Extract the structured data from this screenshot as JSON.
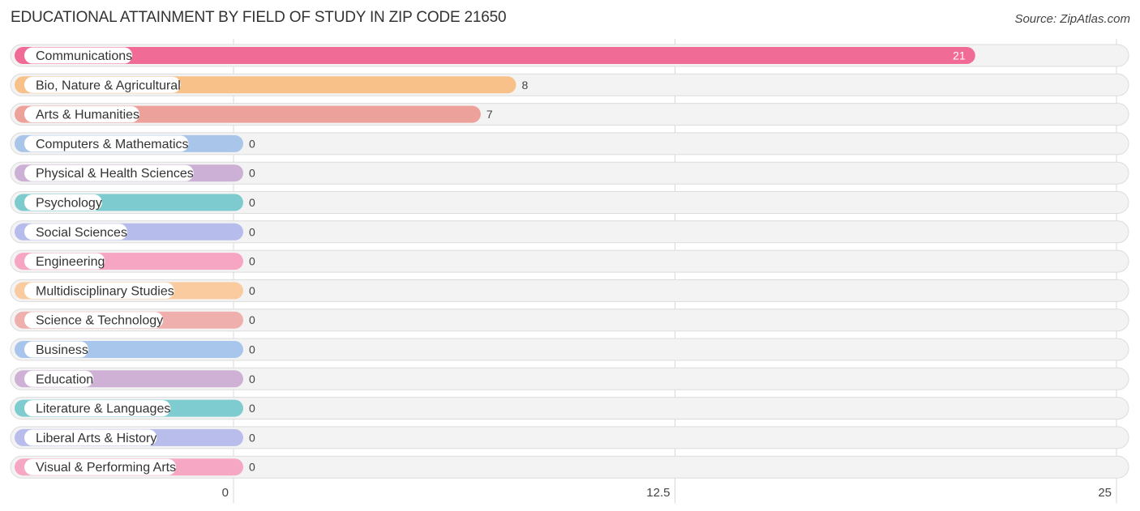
{
  "chart_data": {
    "type": "bar",
    "orientation": "horizontal",
    "title": "EDUCATIONAL ATTAINMENT BY FIELD OF STUDY IN ZIP CODE 21650",
    "source": "Source: ZipAtlas.com",
    "xlabel": "",
    "ylabel": "",
    "xlim": [
      0,
      25
    ],
    "xticks": [
      0,
      12.5,
      25
    ],
    "xtick_labels": [
      "0",
      "12.5",
      "25"
    ],
    "grid": true,
    "categories": [
      "Communications",
      "Bio, Nature & Agricultural",
      "Arts & Humanities",
      "Computers & Mathematics",
      "Physical & Health Sciences",
      "Psychology",
      "Social Sciences",
      "Engineering",
      "Multidisciplinary Studies",
      "Science & Technology",
      "Business",
      "Education",
      "Literature & Languages",
      "Liberal Arts & History",
      "Visual & Performing Arts"
    ],
    "values": [
      21,
      8,
      7,
      0,
      0,
      0,
      0,
      0,
      0,
      0,
      0,
      0,
      0,
      0,
      0
    ],
    "value_labels": [
      "21",
      "8",
      "7",
      "0",
      "0",
      "0",
      "0",
      "0",
      "0",
      "0",
      "0",
      "0",
      "0",
      "0",
      "0"
    ],
    "colors": [
      "#f06b95",
      "#f8c18a",
      "#eda19b",
      "#a9c5ea",
      "#cdb0d5",
      "#7ecbcf",
      "#b6bcec",
      "#f6a5c2",
      "#f9cb9f",
      "#efb0ad",
      "#a8c6eb",
      "#cfb1d6",
      "#7fccd0",
      "#b8bdec",
      "#f6a7c3"
    ]
  }
}
